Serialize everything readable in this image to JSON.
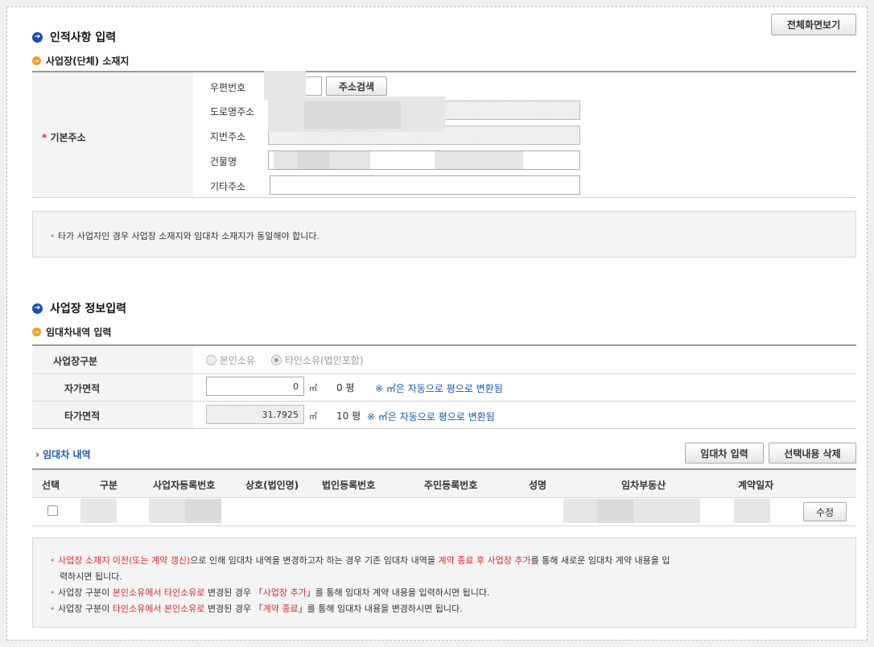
{
  "fullscreen_label": "전체화면보기",
  "section1": {
    "title": "인적사항 입력",
    "subtitle": "사업장(단체) 소재지",
    "address_label": "기본주소",
    "required_mark": "*",
    "zip_label": "우편번호",
    "search_label": "주소검색",
    "road_label": "도로명주소",
    "jibun_label": "지번주소",
    "building_label": "건물명",
    "other_label": "기타주소",
    "notice": "타가 사업자인 경우 사업장 소재지와 임대차 소재지가 동일해야 합니다."
  },
  "section2": {
    "title": "사업장 정보입력",
    "subtitle": "임대차내역 입력",
    "type_label": "사업장구분",
    "radio_own": "본인소유",
    "radio_other": "타인소유(법인포함)",
    "own_area_label": "자가면적",
    "own_area_value": "0",
    "own_pyeong": "0 평",
    "other_area_label": "타가면적",
    "other_area_value": "31.7925",
    "other_pyeong": "10 평",
    "unit_m2": "㎡",
    "conv_note": "※ ㎡은 자동으로 평으로 변환됨",
    "lease_title": "임대차 내역",
    "lease_add": "임대차 입력",
    "lease_delete": "선택내용 삭제",
    "columns": [
      "선택",
      "구분",
      "사업자등록번호",
      "상호(법인명)",
      "법인등록번호",
      "주민등록번호",
      "성명",
      "임차부동산",
      "계약일자"
    ],
    "edit_label": "수정"
  },
  "notes": {
    "n1_a": "사업장 소재지 이전(또는 계약 갱신)",
    "n1_b": "으로 인해 임대차 내역을 변경하고자 하는 경우 기존 임대차 내역을 ",
    "n1_c": "계약 종료 후 사업장 추가",
    "n1_d": "를 통해 새로운 임대차 계약 내용을 입",
    "n1_e": "력하시면 됩니다.",
    "n2_a": "사업장 구분이 ",
    "n2_b": "본인소유에서 타인소유로",
    "n2_c": " 변경된 경우 「",
    "n2_d": "사업장 추가",
    "n2_e": "」를 통해 임대차 계약 내용을 입력하시면 됩니다.",
    "n3_a": "사업장 구분이 ",
    "n3_b": "타인소유에서 본인소유로",
    "n3_c": " 변경된 경우 「",
    "n3_d": "계약 종료",
    "n3_e": "」를 통해 임대차 내용을 변경하시면 됩니다."
  }
}
